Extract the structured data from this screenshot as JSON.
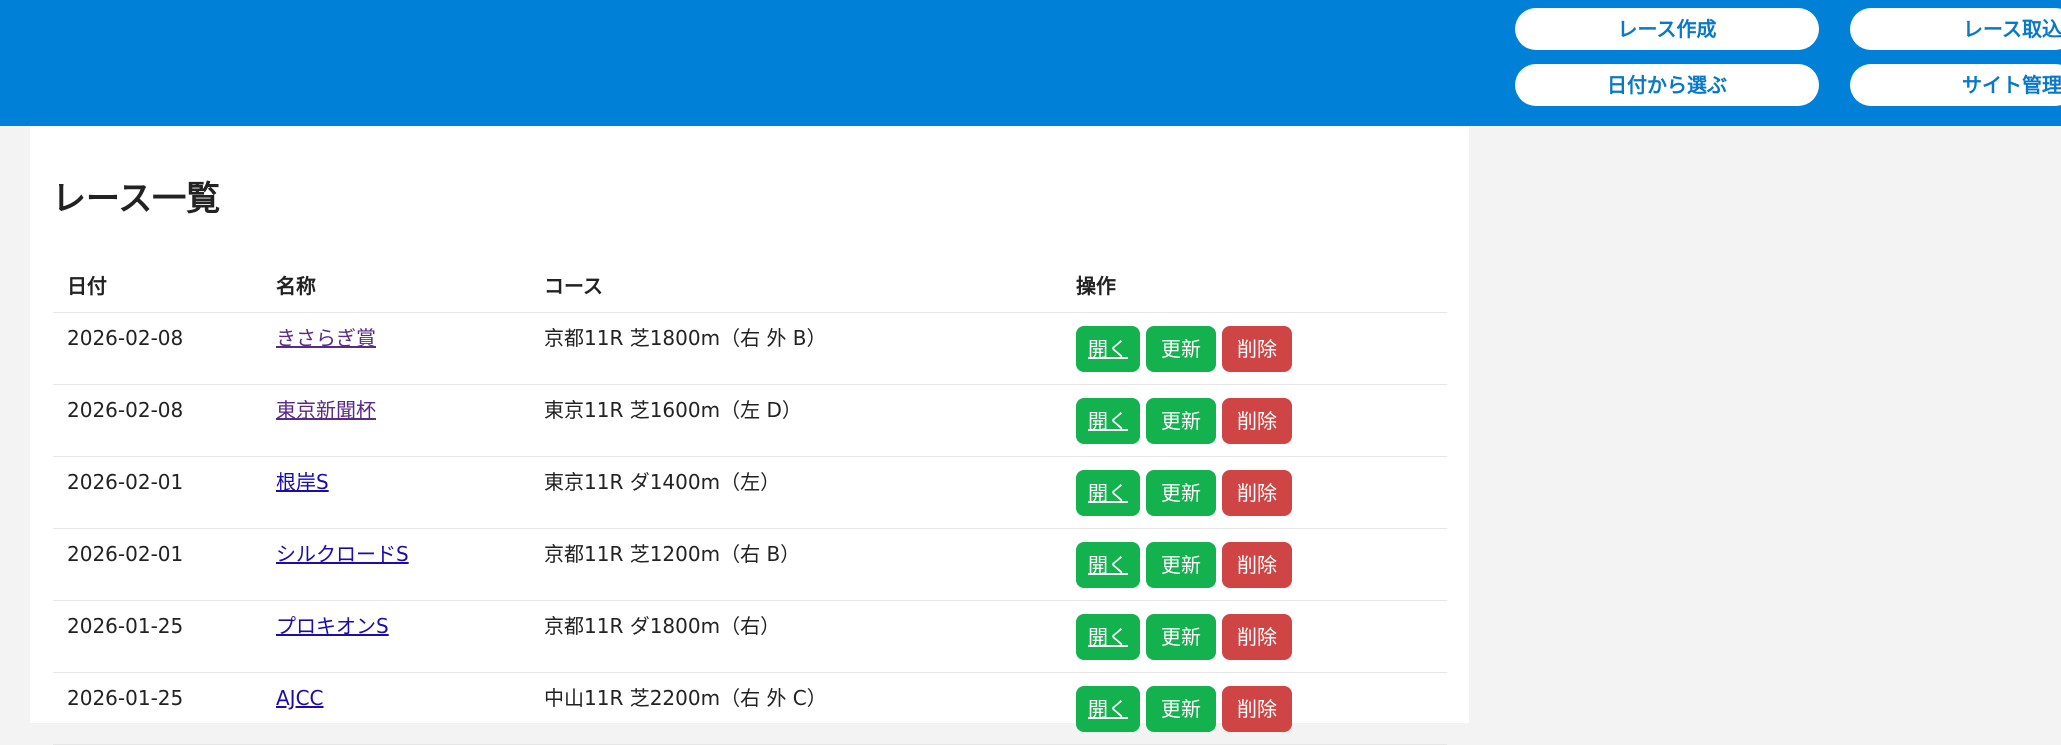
{
  "nav": {
    "create_race": "レース作成",
    "import_race": "レース取込",
    "pick_by_date": "日付から選ぶ",
    "site_admin": "サイト管理"
  },
  "page": {
    "title": "レース一覧"
  },
  "table": {
    "headers": {
      "date": "日付",
      "name": "名称",
      "course": "コース",
      "ops": "操作"
    },
    "rows": [
      {
        "date": "2026-02-08",
        "name": "きさらぎ賞",
        "course": "京都11R 芝1800m（右 外 B）"
      },
      {
        "date": "2026-02-08",
        "name": "東京新聞杯",
        "course": "東京11R 芝1600m（左 D）"
      },
      {
        "date": "2026-02-01",
        "name": "根岸S",
        "course": "東京11R ダ1400m（左）"
      },
      {
        "date": "2026-02-01",
        "name": "シルクロードS",
        "course": "京都11R 芝1200m（右 B）"
      },
      {
        "date": "2026-01-25",
        "name": "プロキオンS",
        "course": "京都11R ダ1800m（右）"
      },
      {
        "date": "2026-01-25",
        "name": "AJCC",
        "course": "中山11R 芝2200m（右 外 C）"
      }
    ],
    "actions": {
      "open": "開く",
      "update": "更新",
      "delete": "削除"
    }
  },
  "colors": {
    "header_bg": "#0080d7",
    "nav_text": "#0a78c8",
    "green": "#13b24e",
    "red": "#cf4444",
    "link": "#1a0dab",
    "link_visited": "#5b2a86"
  }
}
